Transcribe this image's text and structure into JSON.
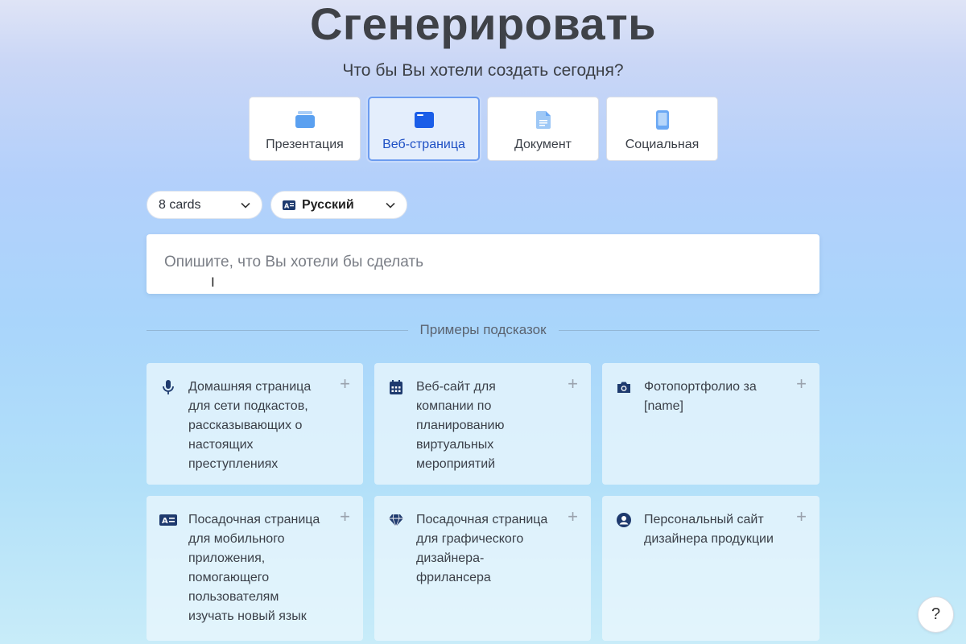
{
  "header": {
    "title": "Сгенерировать",
    "subtitle": "Что бы Вы хотели создать сегодня?"
  },
  "types": [
    {
      "label": "Презентация",
      "icon": "presentation-icon",
      "selected": false
    },
    {
      "label": "Веб-страница",
      "icon": "webpage-icon",
      "selected": true
    },
    {
      "label": "Документ",
      "icon": "document-icon",
      "selected": false
    },
    {
      "label": "Социальная",
      "icon": "phone-icon",
      "selected": false
    }
  ],
  "options": {
    "cards_value": "8 cards",
    "language_value": "Русский"
  },
  "prompt": {
    "placeholder": "Опишите, что Вы хотели бы сделать"
  },
  "examples": {
    "heading": "Примеры подсказок",
    "items": [
      {
        "text": "Домашняя страница для сети подкастов, рассказывающих о настоящих преступлениях",
        "icon": "microphone-icon"
      },
      {
        "text": "Веб-сайт для компании по планированию виртуальных мероприятий",
        "icon": "calendar-icon"
      },
      {
        "text": "Фотопортфолио за [name]",
        "icon": "camera-icon"
      },
      {
        "text": "Посадочная страница для мобильного приложения, помогающего пользователям изучать новый язык",
        "icon": "translate-icon"
      },
      {
        "text": "Посадочная страница для графического дизайнера-фрилансера",
        "icon": "diamond-icon"
      },
      {
        "text": "Персональный сайт дизайнера продукции",
        "icon": "user-circle-icon"
      }
    ]
  },
  "help": {
    "label": "?"
  },
  "colors": {
    "accent": "#1d4fc4",
    "icon_dark": "#1e3a6e",
    "icon_light": "#6aa8f4"
  }
}
